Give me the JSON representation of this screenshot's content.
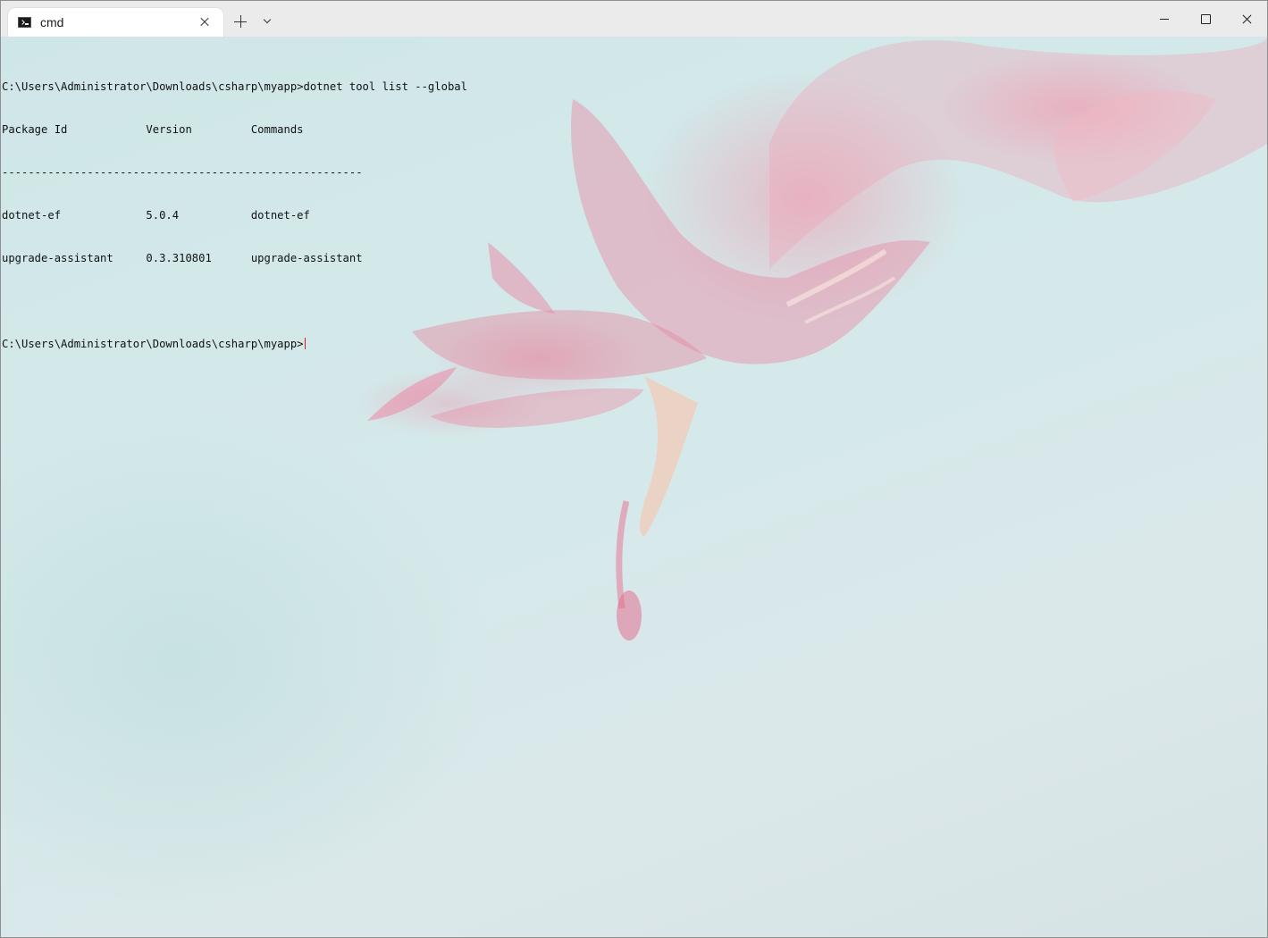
{
  "tab": {
    "title": "cmd",
    "icon": "command-prompt-icon"
  },
  "titlebar": {
    "new_tab_icon": "plus-icon",
    "dropdown_icon": "chevron-down-icon",
    "minimize_icon": "minimize-icon",
    "maximize_icon": "maximize-icon",
    "close_icon": "close-icon"
  },
  "console": {
    "command_line": "C:\\Users\\Administrator\\Downloads\\csharp\\myapp>dotnet tool list --global",
    "header": "Package Id            Version         Commands",
    "separator": "-------------------------------------------------------",
    "rows": [
      "dotnet-ef             5.0.4           dotnet-ef",
      "upgrade-assistant     0.3.310801      upgrade-assistant"
    ],
    "blank": "",
    "prompt": "C:\\Users\\Administrator\\Downloads\\csharp\\myapp>"
  },
  "colors": {
    "cursor": "#e01818",
    "text": "#111111",
    "titlebar": "#ebebeb"
  }
}
